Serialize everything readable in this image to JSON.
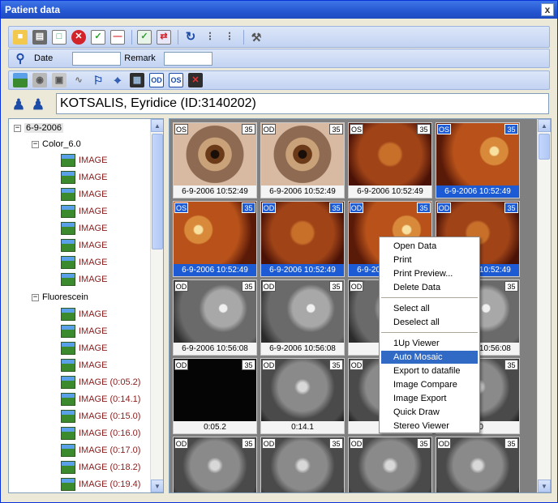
{
  "window": {
    "title": "Patient data",
    "close_label": "x"
  },
  "toolbar1": {
    "buttons": [
      "open-folder",
      "print",
      "print-preview",
      "delete",
      "checklist",
      "remove",
      "verify",
      "transfer",
      "refresh",
      "tree-collapse",
      "tree-expand",
      "tools"
    ]
  },
  "filter": {
    "date_label": "Date",
    "date_value": "",
    "remark_label": "Remark",
    "remark_value": ""
  },
  "toolbar3": {
    "od_label": "OD",
    "os_label": "OS"
  },
  "patient": {
    "name": "KOTSALIS, Eyridice  (ID:3140202)"
  },
  "tree": {
    "root": "6-9-2006",
    "group1": "Color_6.0",
    "group1_items": [
      "IMAGE",
      "IMAGE",
      "IMAGE",
      "IMAGE",
      "IMAGE",
      "IMAGE",
      "IMAGE",
      "IMAGE"
    ],
    "group2": "Fluorescein",
    "group2_items": [
      "IMAGE",
      "IMAGE",
      "IMAGE",
      "IMAGE",
      "IMAGE (0:05.2)",
      "IMAGE (0:14.1)",
      "IMAGE (0:15.0)",
      "IMAGE (0:16.0)",
      "IMAGE (0:17.0)",
      "IMAGE (0:18.2)",
      "IMAGE (0:19.4)"
    ]
  },
  "tiles": [
    {
      "eye": "OS",
      "angle": "35",
      "caption": "6-9-2006 10:52:49",
      "img": "img-eye",
      "sel": false
    },
    {
      "eye": "OD",
      "angle": "35",
      "caption": "6-9-2006 10:52:49",
      "img": "img-eye",
      "sel": false
    },
    {
      "eye": "OS",
      "angle": "35",
      "caption": "6-9-2006 10:52:49",
      "img": "img-fundus-dim",
      "sel": false
    },
    {
      "eye": "OS",
      "angle": "35",
      "caption": "6-9-2006 10:52:49",
      "img": "img-fundus",
      "sel": true
    },
    {
      "eye": "OS",
      "angle": "35",
      "caption": "6-9-2006 10:52:49",
      "img": "img-fundus-c",
      "sel": true
    },
    {
      "eye": "OD",
      "angle": "35",
      "caption": "6-9-2006 10:52:49",
      "img": "img-fundus-dim",
      "sel": true
    },
    {
      "eye": "OD",
      "angle": "35",
      "caption": "6-9-2006 10:52:49",
      "img": "img-fundus",
      "sel": true
    },
    {
      "eye": "OD",
      "angle": "35",
      "caption": "6-9-2006 10:52:49",
      "img": "img-fundus-dim",
      "sel": true
    },
    {
      "eye": "OD",
      "angle": "35",
      "caption": "6-9-2006 10:56:08",
      "img": "img-gray",
      "sel": false
    },
    {
      "eye": "OD",
      "angle": "35",
      "caption": "6-9-2006 10:56:08",
      "img": "img-gray",
      "sel": false
    },
    {
      "eye": "OD",
      "angle": "35",
      "caption": "",
      "img": "img-gray",
      "sel": false
    },
    {
      "eye": "OD",
      "angle": "35",
      "caption": "6-9-2006 10:56:08",
      "img": "img-gray",
      "sel": false
    },
    {
      "eye": "OD",
      "angle": "35",
      "caption": "0:05.2",
      "img": "img-black",
      "sel": false
    },
    {
      "eye": "OD",
      "angle": "35",
      "caption": "0:14.1",
      "img": "img-fa",
      "sel": false
    },
    {
      "eye": "OD",
      "angle": "35",
      "caption": "",
      "img": "img-fa",
      "sel": false
    },
    {
      "eye": "OD",
      "angle": "35",
      "caption": "6.0",
      "img": "img-fa",
      "sel": false
    },
    {
      "eye": "OD",
      "angle": "35",
      "caption": "",
      "img": "img-fa",
      "sel": false
    },
    {
      "eye": "OD",
      "angle": "35",
      "caption": "",
      "img": "img-fa",
      "sel": false
    },
    {
      "eye": "OD",
      "angle": "35",
      "caption": "",
      "img": "img-fa",
      "sel": false
    },
    {
      "eye": "OD",
      "angle": "35",
      "caption": "",
      "img": "img-fa",
      "sel": false
    }
  ],
  "context_menu": {
    "items": [
      {
        "label": "Open Data",
        "hl": false
      },
      {
        "label": "Print",
        "hl": false
      },
      {
        "label": "Print Preview...",
        "hl": false
      },
      {
        "label": "Delete Data",
        "hl": false
      },
      {
        "sep": true
      },
      {
        "label": "Select all",
        "hl": false
      },
      {
        "label": "Deselect all",
        "hl": false
      },
      {
        "sep": true
      },
      {
        "label": "1Up Viewer",
        "hl": false
      },
      {
        "label": "Auto Mosaic",
        "hl": true
      },
      {
        "label": "Export to datafile",
        "hl": false
      },
      {
        "label": "Image Compare",
        "hl": false
      },
      {
        "label": "Image Export",
        "hl": false
      },
      {
        "label": "Quick Draw",
        "hl": false
      },
      {
        "label": "Stereo Viewer",
        "hl": false
      }
    ]
  },
  "colors": {
    "title_bar": "#2556D1",
    "selection": "#1C5BD3",
    "menu_highlight": "#316AC5",
    "image_label": "#8B1A1A"
  }
}
